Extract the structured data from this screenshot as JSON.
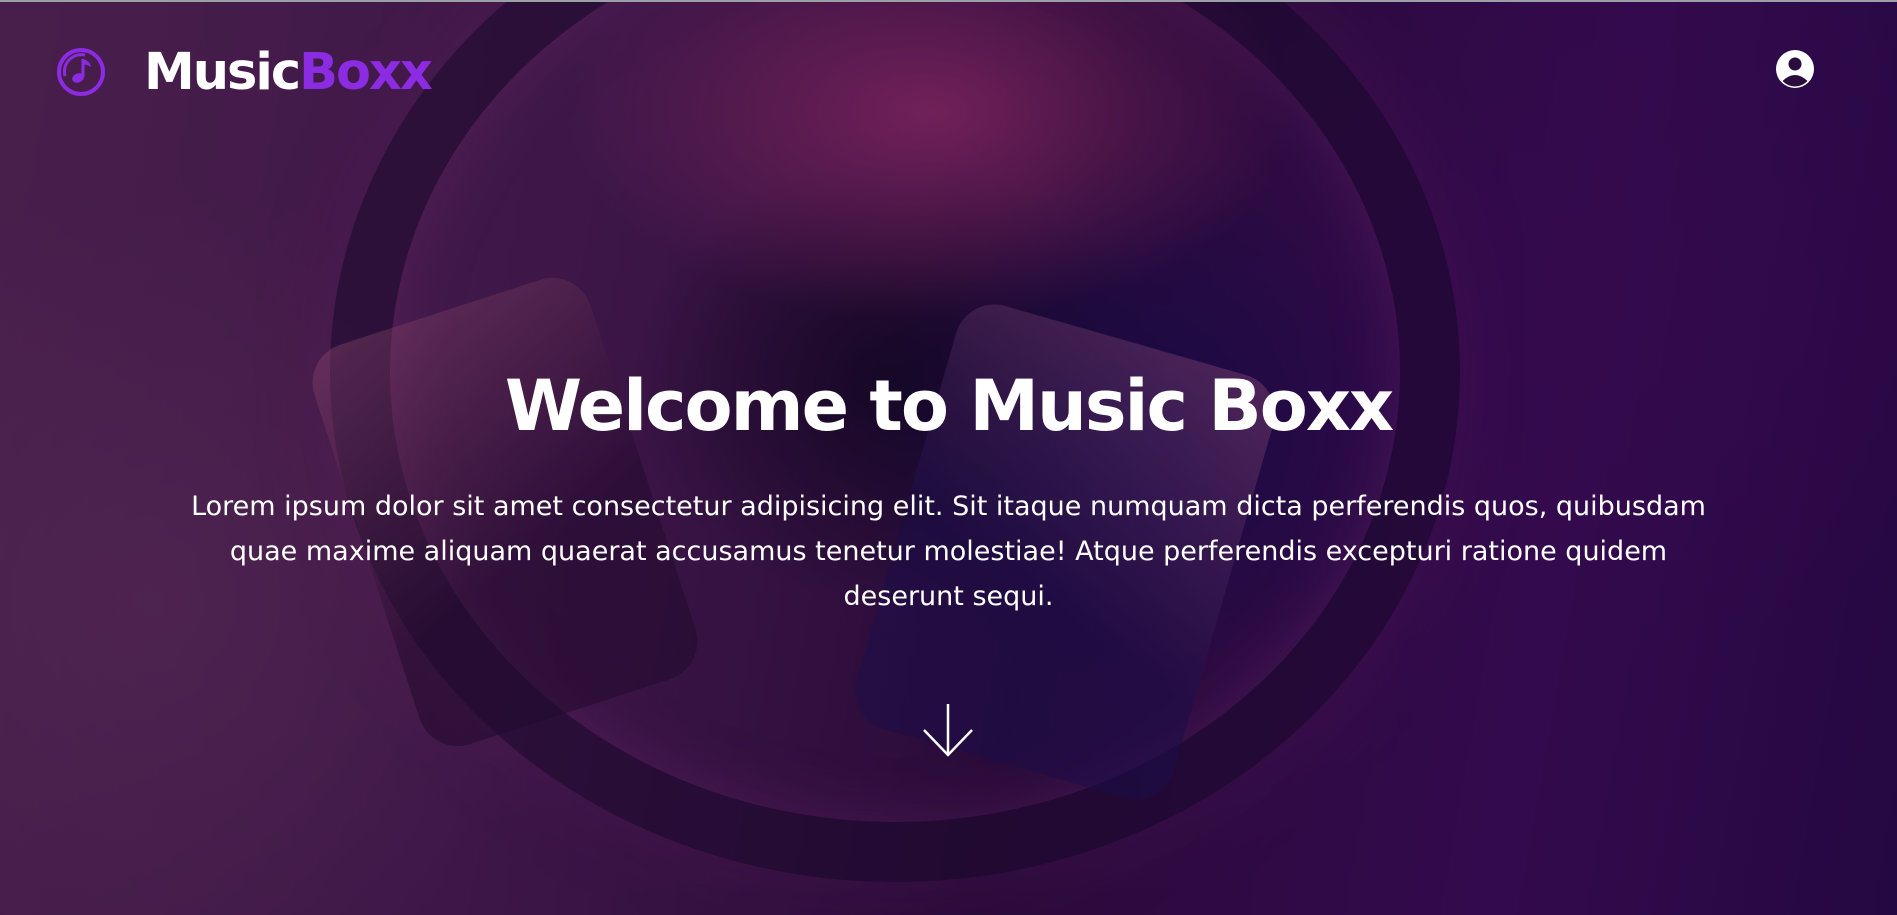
{
  "header": {
    "brand_primary": "Music",
    "brand_secondary": "Boxx",
    "logo_icon": "music-note-disc-icon",
    "account_icon": "user-circle-icon"
  },
  "hero": {
    "title": "Welcome to Music Boxx",
    "description": "Lorem ipsum dolor sit amet consectetur adipisicing elit. Sit itaque numquam dicta perferendis quos, quibusdam quae maxime aliquam quaerat accusamus tenetur molestiae! Atque perferendis excepturi ratione quidem deserunt sequi.",
    "scroll_icon": "arrow-down-icon"
  },
  "colors": {
    "brand_accent": "#8b2be2",
    "text": "#ffffff"
  }
}
